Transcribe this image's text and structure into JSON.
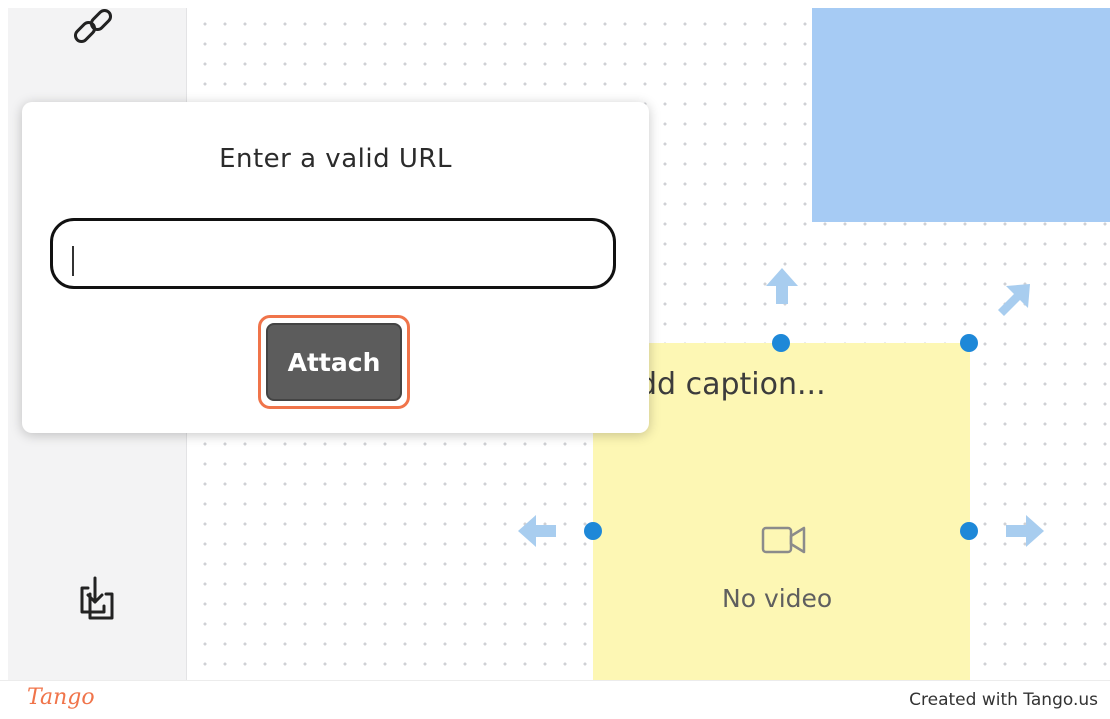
{
  "sidebar": {
    "top_icon": "link-icon",
    "bottom_icon": "download-icon"
  },
  "canvas": {
    "blue_note_color": "#a6cbf4",
    "yellow_note_color": "#fdf7b4",
    "handle_color": "#1e88d8",
    "arrow_color": "#a8cdef",
    "caption_text": "dd caption...",
    "no_video_text": "No video",
    "video_icon": "video-camera-icon"
  },
  "modal": {
    "title": "Enter a valid URL",
    "url_value": "",
    "url_placeholder": "",
    "attach_label": "Attach",
    "highlight_color": "#f0744a"
  },
  "footer": {
    "logo_text": "Tango",
    "credit": "Created with Tango.us"
  }
}
